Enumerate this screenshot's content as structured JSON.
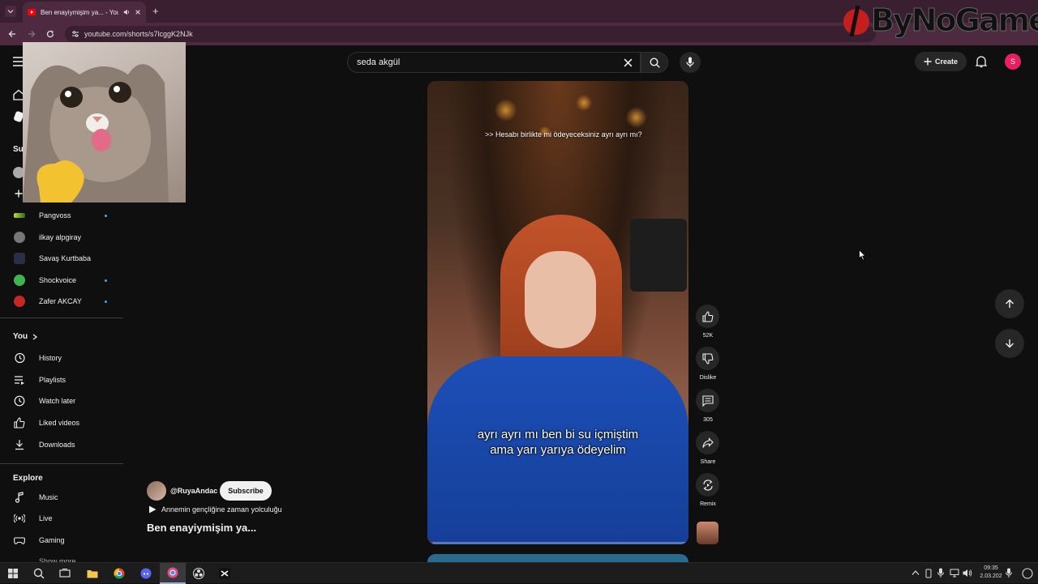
{
  "browser": {
    "tab_title": "Ben enayiymişim ya... - You",
    "new_tab": "+",
    "url": "youtube.com/shorts/s7lcggK2NJk"
  },
  "overlay_logo": {
    "text": "ByNoGame"
  },
  "masthead": {
    "search_value": "seda akgül",
    "create_label": "Create",
    "avatar_letter": "S"
  },
  "sidebar": {
    "subscriptions_head": "Su",
    "subscriptions": [
      {
        "label": "Pangvoss",
        "dot": true
      },
      {
        "label": "ilkay alpgiray",
        "dot": false
      },
      {
        "label": "Savaş Kurtbaba",
        "dot": false
      },
      {
        "label": "Shockvoice",
        "dot": true
      },
      {
        "label": "Zafer AKCAY",
        "dot": true
      }
    ],
    "you_head": "You",
    "you_items": [
      {
        "label": "History",
        "icon": "history-icon"
      },
      {
        "label": "Playlists",
        "icon": "playlists-icon"
      },
      {
        "label": "Watch later",
        "icon": "watch-later-icon"
      },
      {
        "label": "Liked videos",
        "icon": "like-icon"
      },
      {
        "label": "Downloads",
        "icon": "download-icon"
      }
    ],
    "explore_head": "Explore",
    "explore_items": [
      {
        "label": "Music",
        "icon": "music-icon"
      },
      {
        "label": "Live",
        "icon": "live-icon"
      },
      {
        "label": "Gaming",
        "icon": "gaming-icon"
      }
    ],
    "show_more": "Show more"
  },
  "video": {
    "caption_top": ">> Hesabı birlikte mi ödeyeceksiniz ayrı ayrı mı?",
    "caption_main_line1": "ayrı ayrı mı ben bi su içmiştim",
    "caption_main_line2": "ama yarı yarıya ödeyelim",
    "progress": 0.02
  },
  "actions": {
    "like_count": "52K",
    "dislike_label": "Dislike",
    "comments_count": "305",
    "share_label": "Share",
    "remix_label": "Remix"
  },
  "channel": {
    "handle": "@RuyaAndac",
    "subscribe_label": "Subscribe",
    "music": "Annemin gençliğine zaman yolculuğu",
    "title": "Ben enayiymişim ya..."
  },
  "taskbar": {
    "time": "09:35",
    "date": "2.03.202"
  }
}
